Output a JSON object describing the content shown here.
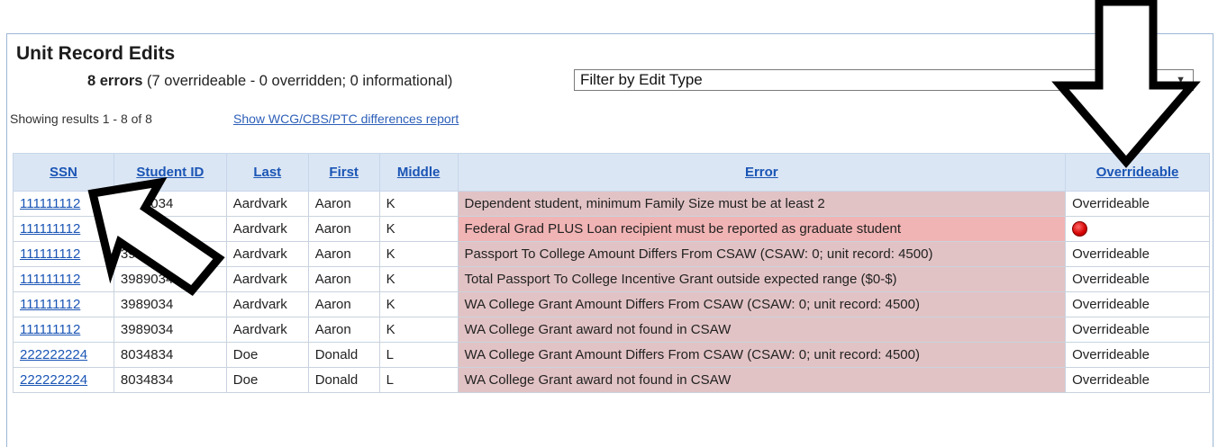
{
  "panel": {
    "title": "Unit Record Edits",
    "summary_bold": "8 errors",
    "summary_rest": " (7 overrideable - 0 overridden; 0 informational)",
    "filter_value": "Filter by Edit Type",
    "showing": "Showing results 1 - 8 of 8",
    "diff_link": "Show WCG/CBS/PTC differences report"
  },
  "table": {
    "headers": [
      "SSN",
      "Student ID",
      "Last",
      "First",
      "Middle",
      "Error",
      "Overrideable"
    ],
    "rows": [
      {
        "ssn": "111111112",
        "student_id": "3989034",
        "last": "Aardvark",
        "first": "Aaron",
        "middle": "K",
        "error": "Dependent student, minimum Family Size must be at least 2",
        "overrideable": "Overrideable"
      },
      {
        "ssn": "111111112",
        "student_id": "3989034",
        "last": "Aardvark",
        "first": "Aaron",
        "middle": "K",
        "error": "Federal Grad PLUS Loan recipient must be reported as graduate student",
        "overrideable": ""
      },
      {
        "ssn": "111111112",
        "student_id": "3989034",
        "last": "Aardvark",
        "first": "Aaron",
        "middle": "K",
        "error": "Passport To College Amount Differs From CSAW (CSAW: 0; unit record: 4500)",
        "overrideable": "Overrideable"
      },
      {
        "ssn": "111111112",
        "student_id": "3989034",
        "last": "Aardvark",
        "first": "Aaron",
        "middle": "K",
        "error": "Total Passport To College Incentive Grant outside expected range ($0-$)",
        "overrideable": "Overrideable"
      },
      {
        "ssn": "111111112",
        "student_id": "3989034",
        "last": "Aardvark",
        "first": "Aaron",
        "middle": "K",
        "error": "WA College Grant Amount Differs From CSAW (CSAW: 0; unit record: 4500)",
        "overrideable": "Overrideable"
      },
      {
        "ssn": "111111112",
        "student_id": "3989034",
        "last": "Aardvark",
        "first": "Aaron",
        "middle": "K",
        "error": "WA College Grant award not found in CSAW",
        "overrideable": "Overrideable"
      },
      {
        "ssn": "222222224",
        "student_id": "8034834",
        "last": "Doe",
        "first": "Donald",
        "middle": "L",
        "error": "WA College Grant Amount Differs From CSAW (CSAW: 0; unit record: 4500)",
        "overrideable": "Overrideable"
      },
      {
        "ssn": "222222224",
        "student_id": "8034834",
        "last": "Doe",
        "first": "Donald",
        "middle": "L",
        "error": "WA College Grant award not found in CSAW",
        "overrideable": "Overrideable"
      }
    ]
  },
  "icons": {
    "non_overrideable": "stop-icon",
    "annotation_down": "down-arrow-icon",
    "annotation_diag": "diagonal-arrow-icon"
  },
  "colors": {
    "header_bg": "#dbe6f4",
    "error_bg": "#e2c3c5",
    "error_highlight_bg": "#f1b4b4",
    "link": "#1a55b5",
    "stop": "#d40000"
  }
}
